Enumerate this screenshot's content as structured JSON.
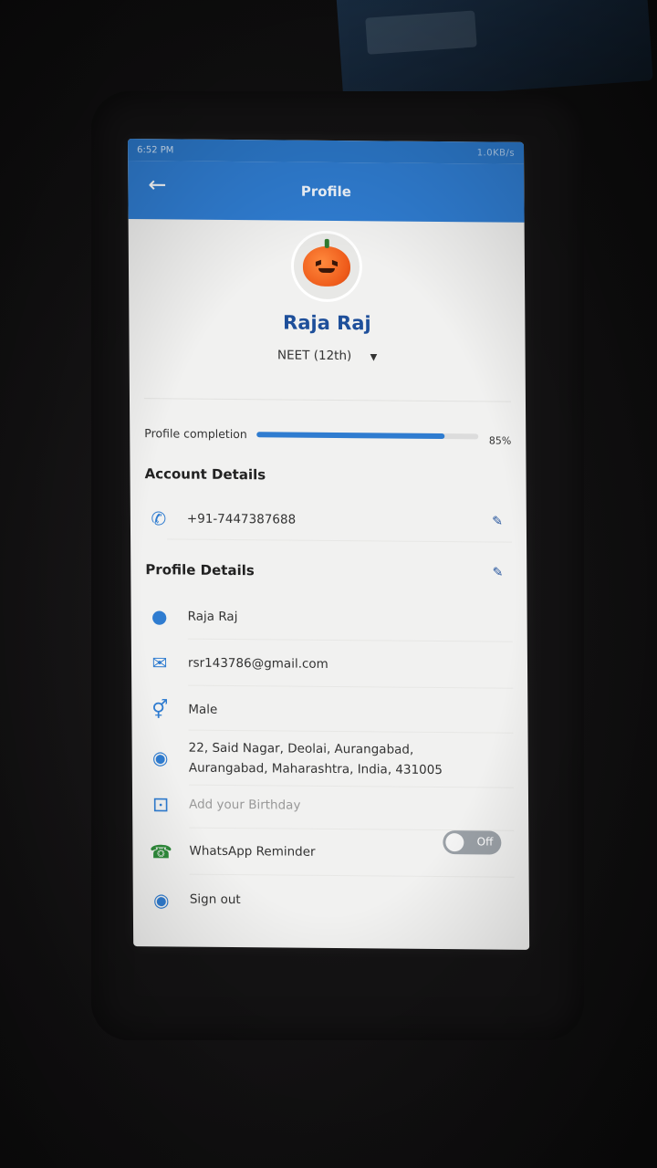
{
  "status_bar": {
    "time": "6:52 PM",
    "right": "1.0KB/s"
  },
  "appbar": {
    "title": "Profile",
    "back_icon": "arrow-left-icon"
  },
  "profile": {
    "name": "Raja Raj",
    "exam": "NEET (12th)"
  },
  "completion": {
    "label": "Profile completion",
    "percent": "85%",
    "value": 0.85
  },
  "account_details": {
    "title": "Account Details",
    "phone": "+91-7447387688"
  },
  "profile_details": {
    "title": "Profile Details",
    "name": "Raja Raj",
    "email": "rsr143786@gmail.com",
    "gender": "Male",
    "address": "22, Said Nagar, Deolai, Aurangabad, Aurangabad, Maharashtra, India, 431005",
    "birthday_placeholder": "Add your Birthday",
    "whatsapp_label": "WhatsApp Reminder",
    "whatsapp_toggle": "Off",
    "sign_out": "Sign out"
  },
  "colors": {
    "primary": "#2f7cd0",
    "name_text": "#1e4f9a"
  }
}
